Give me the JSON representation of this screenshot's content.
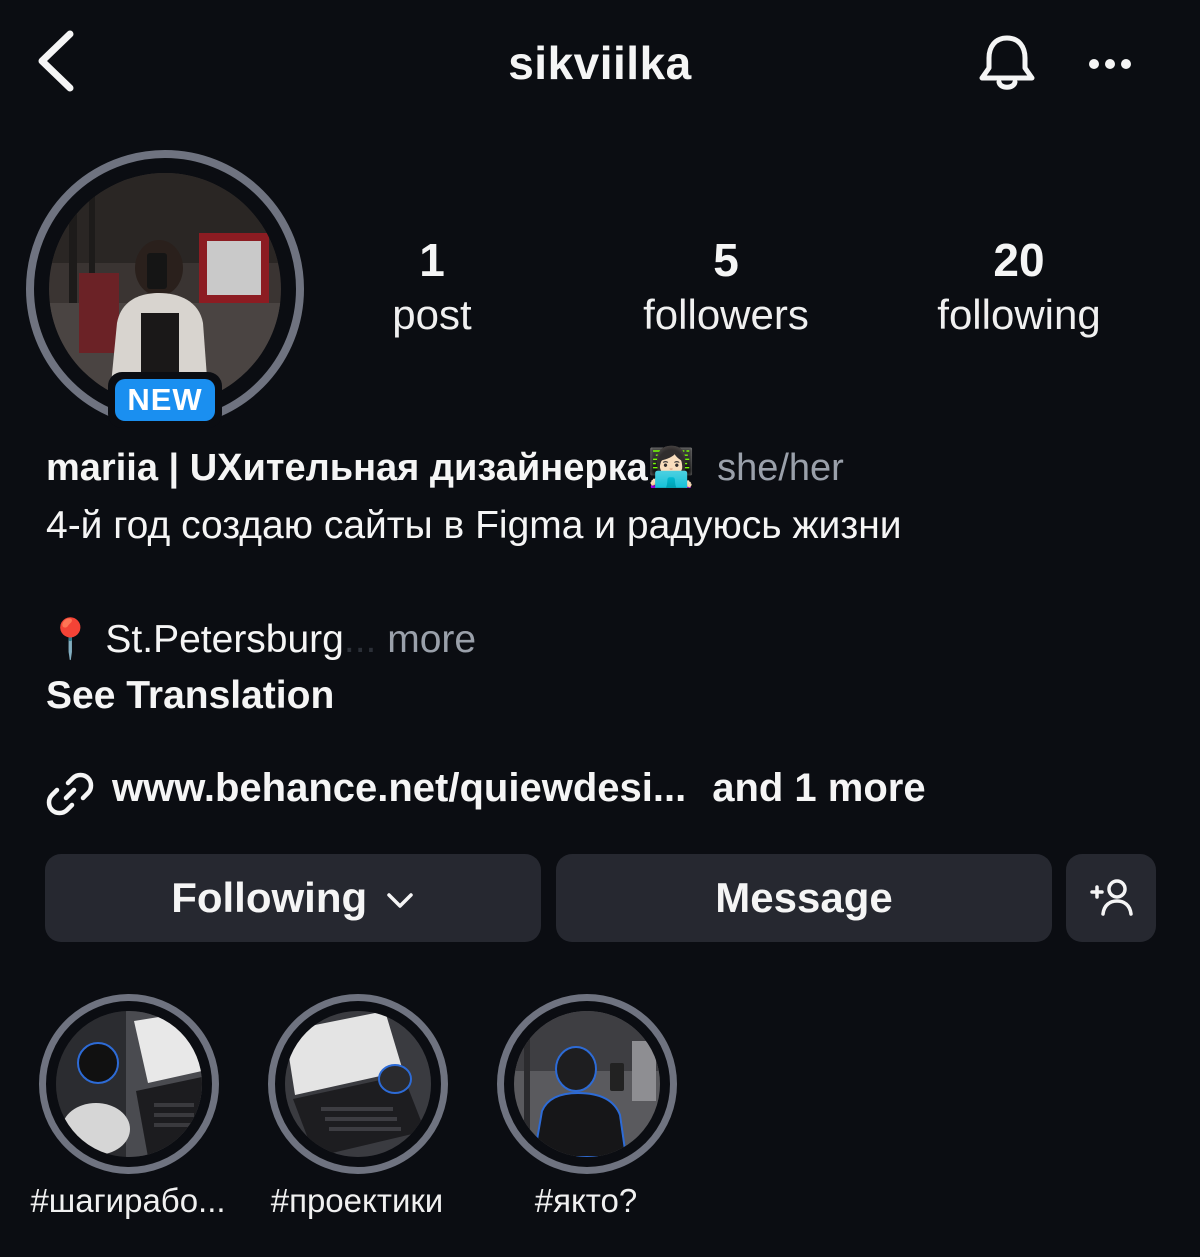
{
  "header": {
    "username": "sikviilka",
    "icons": {
      "back": "chevron-left-icon",
      "notifications": "bell-icon",
      "more": "more-horizontal-icon"
    }
  },
  "profile": {
    "new_badge": "NEW",
    "stats": [
      {
        "value": "1",
        "label": "post"
      },
      {
        "value": "5",
        "label": "followers"
      },
      {
        "value": "20",
        "label": "following"
      }
    ],
    "display_name": "mariia | UXительная дизайнерка",
    "name_emoji": "👩🏻‍💻",
    "pronouns": "she/her",
    "bio_line": "4-й год создаю сайты в Figma и радуюсь жизни",
    "location_pin": "📍",
    "location": "St.Petersburg",
    "ellipsis": "...",
    "more_label": "more",
    "see_translation": "See Translation",
    "link_text": "www.behance.net/quiewdesi...",
    "link_more": "and 1 more"
  },
  "actions": {
    "following_label": "Following",
    "message_label": "Message",
    "add_user_icon": "add-person-icon"
  },
  "highlights": [
    {
      "label": "#шагирабо..."
    },
    {
      "label": "#проектики"
    },
    {
      "label": "#якто?"
    }
  ],
  "colors": {
    "background": "#0b0d12",
    "button": "#262830",
    "badge": "#1a8ff0",
    "muted_text": "#9aa0aa",
    "ring": "#6f7380"
  }
}
